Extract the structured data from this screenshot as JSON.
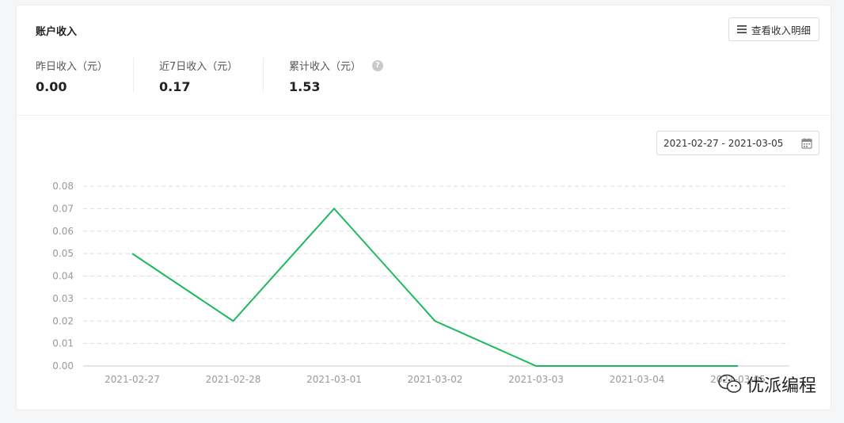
{
  "header": {
    "title": "账户收入",
    "detail_button_label": "查看收入明细"
  },
  "stats": [
    {
      "label": "昨日收入（元）",
      "value": "0.00"
    },
    {
      "label": "近7日收入（元）",
      "value": "0.17"
    },
    {
      "label": "累计收入（元）",
      "value": "1.53",
      "help": "?"
    }
  ],
  "date_range": {
    "value": "2021-02-27 - 2021-03-05"
  },
  "watermark": {
    "text": "优派编程"
  },
  "colors": {
    "line": "#1db960",
    "grid": "#dddddd",
    "axis_text": "#999999"
  },
  "chart_data": {
    "type": "line",
    "categories": [
      "2021-02-27",
      "2021-02-28",
      "2021-03-01",
      "2021-03-02",
      "2021-03-03",
      "2021-03-04",
      "2021-03-05"
    ],
    "values": [
      0.05,
      0.02,
      0.07,
      0.02,
      0.0,
      0.0,
      0.0
    ],
    "ylim": [
      0,
      0.08
    ],
    "yticks": [
      "0.00",
      "0.01",
      "0.02",
      "0.03",
      "0.04",
      "0.05",
      "0.06",
      "0.07",
      "0.08"
    ],
    "grid": true
  }
}
